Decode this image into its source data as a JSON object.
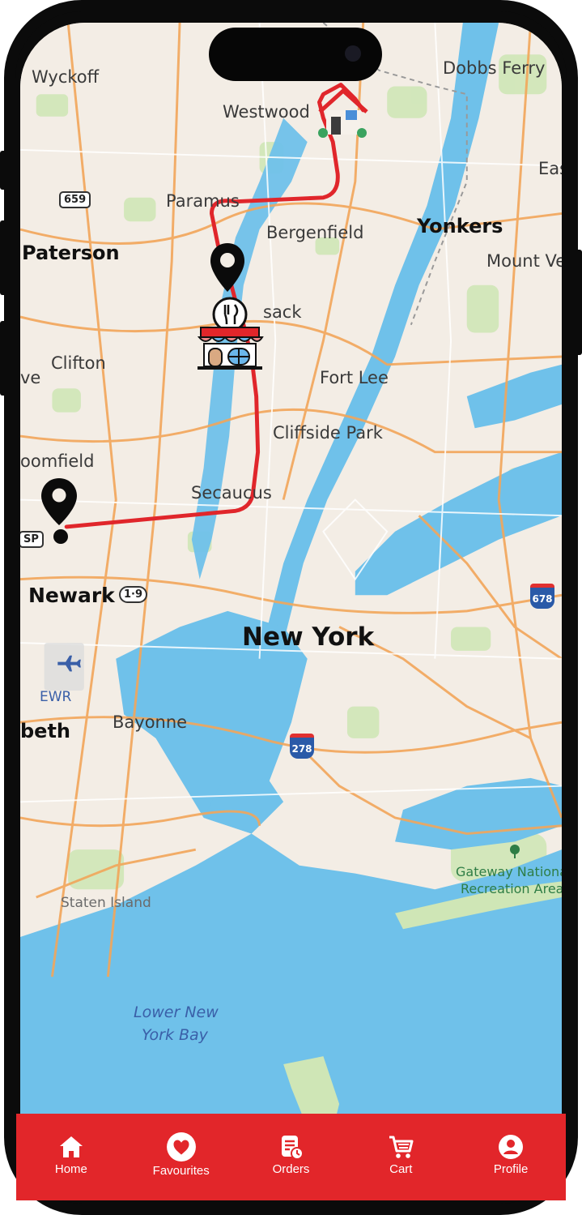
{
  "map": {
    "places": {
      "wyckoff": "Wyckoff",
      "dobbs_ferry": "Dobbs Ferry",
      "westwood": "Westwood",
      "east": "Eas",
      "paramus": "Paramus",
      "bergenfield": "Bergenfield",
      "yonkers": "Yonkers",
      "paterson": "Paterson",
      "mount_vernon": "Mount Ver",
      "hackensack": "sack",
      "clifton": "Clifton",
      "ve": "ve",
      "fort_lee": "Fort Lee",
      "cliffside_park": "Cliffside Park",
      "bloomfield": "oomfield",
      "secaucus": "Secaucus",
      "newark": "Newark",
      "new_york": "New York",
      "ewr": "EWR",
      "elizabeth": "beth",
      "bayonne": "Bayonne",
      "staten_island": "Staten Island",
      "gateway_line1": "Gateway Nationa",
      "gateway_line2": "Recreation Area",
      "lower_bay_line1": "Lower New",
      "lower_bay_line2": "York Bay"
    },
    "shields": {
      "r659": "659",
      "r1_9": "1·9",
      "gsp": "SP",
      "i678": "678",
      "i278": "278"
    },
    "markers": {
      "home": "home-destination",
      "restaurant": "restaurant-pickup",
      "rider": "current-location"
    },
    "route_color": "#e0262b"
  },
  "nav": {
    "background": "#e2262a",
    "items": [
      {
        "label": "Home",
        "icon": "home-icon"
      },
      {
        "label": "Favourites",
        "icon": "heart-icon"
      },
      {
        "label": "Orders",
        "icon": "orders-icon"
      },
      {
        "label": "Cart",
        "icon": "cart-icon"
      },
      {
        "label": "Profile",
        "icon": "profile-icon"
      }
    ]
  }
}
